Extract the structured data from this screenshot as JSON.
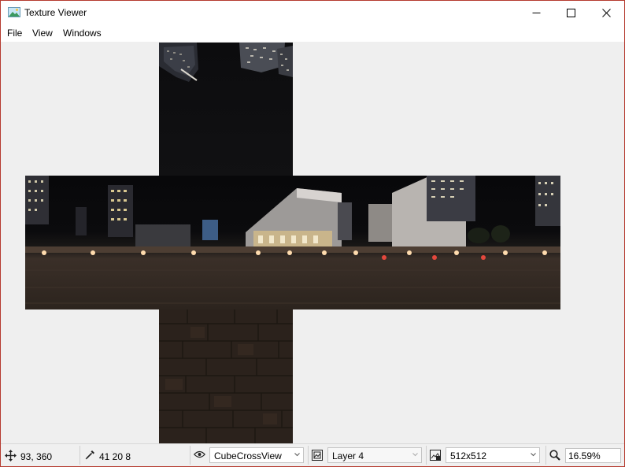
{
  "window": {
    "title": "Texture Viewer"
  },
  "menu": {
    "items": [
      "File",
      "View",
      "Windows"
    ]
  },
  "status": {
    "cursor_position": "93, 360",
    "picked_value": "41 20 8",
    "view_mode": "CubeCrossView",
    "layer": "Layer 4",
    "mip_size": "512x512",
    "zoom": "16.59%"
  },
  "colors": {
    "window_border": "#b53a2f",
    "canvas_background": "#efefef",
    "floor": "#2b221c",
    "sky": "#0c0c0e"
  },
  "icons": [
    "app-icon",
    "minimize-icon",
    "maximize-icon",
    "close-icon",
    "move-icon",
    "eyedropper-icon",
    "eye-icon",
    "layer-icon",
    "mip-icon",
    "zoom-icon",
    "chevron-down-icon"
  ]
}
